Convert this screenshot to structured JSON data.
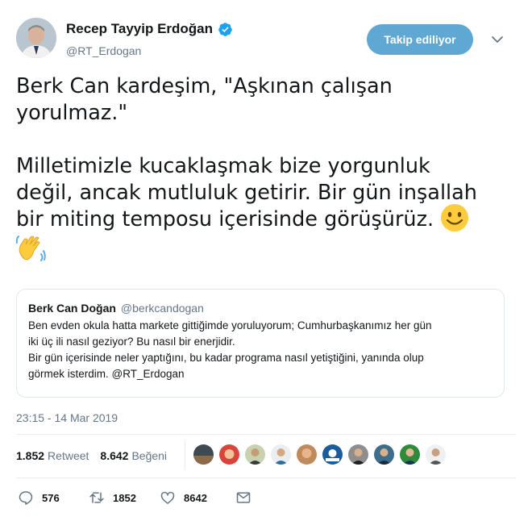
{
  "author": {
    "name": "Recep Tayyip Erdoğan",
    "handle": "@RT_Erdogan"
  },
  "follow_button": "Takip ediliyor",
  "tweet": {
    "paragraph1": "Berk Can kardeşim, \"Aşkınan çalışan\nyorulmaz.\"",
    "paragraph2": "Milletimizle kucaklaşmak bize yorgunluk\ndeğil, ancak mutluluk getirir. Bir gün inşallah\nbir miting temposu içerisinde görüşürüz."
  },
  "quoted": {
    "name": "Berk Can Doğan",
    "handle": "@berkcandogan",
    "text": "Ben evden okula hatta markete gittiğimde yoruluyorum; Cumhurbaşkanımız her gün\niki üç ili nasıl geziyor? Bu nasıl bir enerjidir.\nBir gün içerisinde neler yaptığını, bu kadar programa nasıl yetiştiğini, yanında olup\ngörmek isterdim. @RT_Erdogan"
  },
  "timestamp": "23:15 - 14 Mar 2019",
  "stats": {
    "retweets": "1.852",
    "retweets_label": "Retweet",
    "likes": "8.642",
    "likes_label": "Beğeni"
  },
  "actions": {
    "replies": "576",
    "retweets": "1852",
    "likes": "8642"
  },
  "colors": {
    "follow_button": "#5fa8d3",
    "verified": "#1da1f2",
    "secondary_text": "#657786"
  },
  "icons": [
    "verified-badge-icon",
    "chevron-down-icon",
    "smiley-emoji",
    "waving-hand-emoji",
    "reply-icon",
    "retweet-icon",
    "like-icon",
    "message-icon"
  ]
}
